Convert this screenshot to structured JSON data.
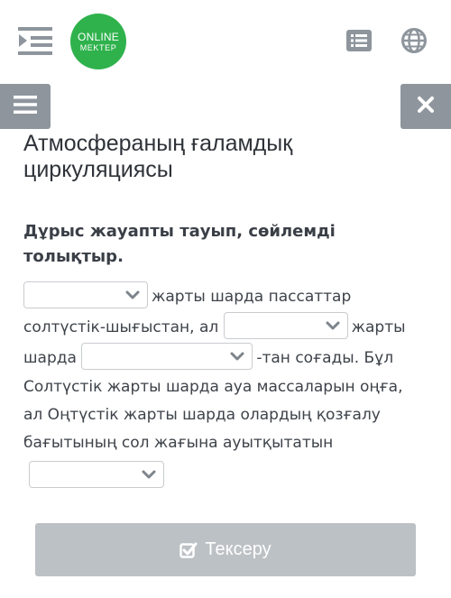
{
  "header": {
    "logo": {
      "line1": "ONLINE",
      "line2": "MEKTEP"
    }
  },
  "lesson": {
    "title": "Атмосфераның ғаламдық циркуляциясы",
    "instruction": "Дұрыс жауапты тауып, сөйлемді толықтыр.",
    "passage": {
      "part1": "жарты шарда пассаттар солтүстік-шығыстан, ал",
      "part2": "жарты шарда",
      "part3": "-тан соғады. Бұл Солтүстік жарты шарда ауа массаларын оңға, ал Оңтүстік жарты шарда олардың қозғалу бағытының сол жағына ауытқытатын"
    }
  },
  "check_button": {
    "label": "Тексеру"
  },
  "colors": {
    "logo_green": "#2fb24c",
    "icon_gray": "#8e959c",
    "button_gray": "#bcc1c5"
  }
}
